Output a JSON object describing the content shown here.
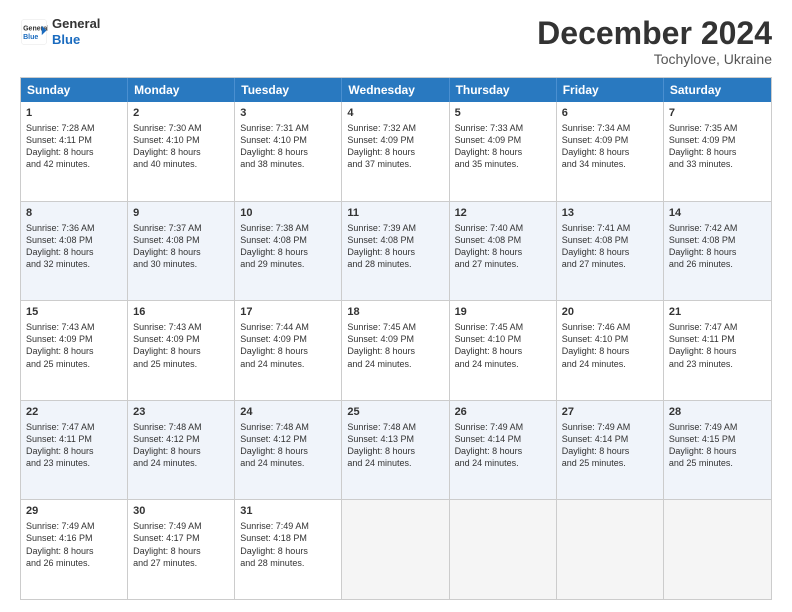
{
  "header": {
    "logo_line1": "General",
    "logo_line2": "Blue",
    "month": "December 2024",
    "location": "Tochylove, Ukraine"
  },
  "days_of_week": [
    "Sunday",
    "Monday",
    "Tuesday",
    "Wednesday",
    "Thursday",
    "Friday",
    "Saturday"
  ],
  "weeks": [
    [
      {
        "day": "1",
        "info": "Sunrise: 7:28 AM\nSunset: 4:11 PM\nDaylight: 8 hours\nand 42 minutes."
      },
      {
        "day": "2",
        "info": "Sunrise: 7:30 AM\nSunset: 4:10 PM\nDaylight: 8 hours\nand 40 minutes."
      },
      {
        "day": "3",
        "info": "Sunrise: 7:31 AM\nSunset: 4:10 PM\nDaylight: 8 hours\nand 38 minutes."
      },
      {
        "day": "4",
        "info": "Sunrise: 7:32 AM\nSunset: 4:09 PM\nDaylight: 8 hours\nand 37 minutes."
      },
      {
        "day": "5",
        "info": "Sunrise: 7:33 AM\nSunset: 4:09 PM\nDaylight: 8 hours\nand 35 minutes."
      },
      {
        "day": "6",
        "info": "Sunrise: 7:34 AM\nSunset: 4:09 PM\nDaylight: 8 hours\nand 34 minutes."
      },
      {
        "day": "7",
        "info": "Sunrise: 7:35 AM\nSunset: 4:09 PM\nDaylight: 8 hours\nand 33 minutes."
      }
    ],
    [
      {
        "day": "8",
        "info": "Sunrise: 7:36 AM\nSunset: 4:08 PM\nDaylight: 8 hours\nand 32 minutes."
      },
      {
        "day": "9",
        "info": "Sunrise: 7:37 AM\nSunset: 4:08 PM\nDaylight: 8 hours\nand 30 minutes."
      },
      {
        "day": "10",
        "info": "Sunrise: 7:38 AM\nSunset: 4:08 PM\nDaylight: 8 hours\nand 29 minutes."
      },
      {
        "day": "11",
        "info": "Sunrise: 7:39 AM\nSunset: 4:08 PM\nDaylight: 8 hours\nand 28 minutes."
      },
      {
        "day": "12",
        "info": "Sunrise: 7:40 AM\nSunset: 4:08 PM\nDaylight: 8 hours\nand 27 minutes."
      },
      {
        "day": "13",
        "info": "Sunrise: 7:41 AM\nSunset: 4:08 PM\nDaylight: 8 hours\nand 27 minutes."
      },
      {
        "day": "14",
        "info": "Sunrise: 7:42 AM\nSunset: 4:08 PM\nDaylight: 8 hours\nand 26 minutes."
      }
    ],
    [
      {
        "day": "15",
        "info": "Sunrise: 7:43 AM\nSunset: 4:09 PM\nDaylight: 8 hours\nand 25 minutes."
      },
      {
        "day": "16",
        "info": "Sunrise: 7:43 AM\nSunset: 4:09 PM\nDaylight: 8 hours\nand 25 minutes."
      },
      {
        "day": "17",
        "info": "Sunrise: 7:44 AM\nSunset: 4:09 PM\nDaylight: 8 hours\nand 24 minutes."
      },
      {
        "day": "18",
        "info": "Sunrise: 7:45 AM\nSunset: 4:09 PM\nDaylight: 8 hours\nand 24 minutes."
      },
      {
        "day": "19",
        "info": "Sunrise: 7:45 AM\nSunset: 4:10 PM\nDaylight: 8 hours\nand 24 minutes."
      },
      {
        "day": "20",
        "info": "Sunrise: 7:46 AM\nSunset: 4:10 PM\nDaylight: 8 hours\nand 24 minutes."
      },
      {
        "day": "21",
        "info": "Sunrise: 7:47 AM\nSunset: 4:11 PM\nDaylight: 8 hours\nand 23 minutes."
      }
    ],
    [
      {
        "day": "22",
        "info": "Sunrise: 7:47 AM\nSunset: 4:11 PM\nDaylight: 8 hours\nand 23 minutes."
      },
      {
        "day": "23",
        "info": "Sunrise: 7:48 AM\nSunset: 4:12 PM\nDaylight: 8 hours\nand 24 minutes."
      },
      {
        "day": "24",
        "info": "Sunrise: 7:48 AM\nSunset: 4:12 PM\nDaylight: 8 hours\nand 24 minutes."
      },
      {
        "day": "25",
        "info": "Sunrise: 7:48 AM\nSunset: 4:13 PM\nDaylight: 8 hours\nand 24 minutes."
      },
      {
        "day": "26",
        "info": "Sunrise: 7:49 AM\nSunset: 4:14 PM\nDaylight: 8 hours\nand 24 minutes."
      },
      {
        "day": "27",
        "info": "Sunrise: 7:49 AM\nSunset: 4:14 PM\nDaylight: 8 hours\nand 25 minutes."
      },
      {
        "day": "28",
        "info": "Sunrise: 7:49 AM\nSunset: 4:15 PM\nDaylight: 8 hours\nand 25 minutes."
      }
    ],
    [
      {
        "day": "29",
        "info": "Sunrise: 7:49 AM\nSunset: 4:16 PM\nDaylight: 8 hours\nand 26 minutes."
      },
      {
        "day": "30",
        "info": "Sunrise: 7:49 AM\nSunset: 4:17 PM\nDaylight: 8 hours\nand 27 minutes."
      },
      {
        "day": "31",
        "info": "Sunrise: 7:49 AM\nSunset: 4:18 PM\nDaylight: 8 hours\nand 28 minutes."
      },
      {
        "day": "",
        "info": ""
      },
      {
        "day": "",
        "info": ""
      },
      {
        "day": "",
        "info": ""
      },
      {
        "day": "",
        "info": ""
      }
    ]
  ]
}
